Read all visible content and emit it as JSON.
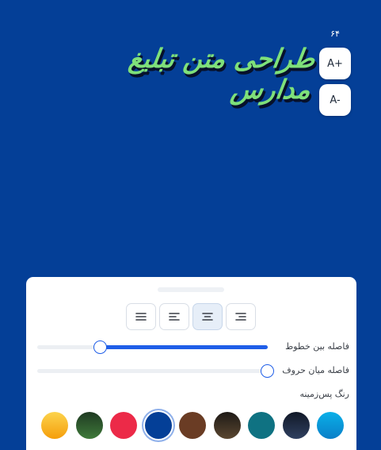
{
  "canvas": {
    "background_color": "#043f97",
    "headline_text": "طراحی متن تبلیغ مدارس",
    "headline_color": "#7ee07a",
    "font_size_value": "۶۴"
  },
  "size_controls": {
    "increase_label": "A+",
    "decrease_label": "A-"
  },
  "panel": {
    "alignment_options": [
      {
        "name": "justify",
        "icon": "align-justify-icon",
        "selected": false
      },
      {
        "name": "left",
        "icon": "align-left-icon",
        "selected": false
      },
      {
        "name": "center",
        "icon": "align-center-icon",
        "selected": true
      },
      {
        "name": "right",
        "icon": "align-right-icon",
        "selected": false
      }
    ],
    "line_spacing": {
      "label": "فاصله بین خطوط",
      "value_fraction": 0.73
    },
    "letter_spacing": {
      "label": "فاصله میان حروف",
      "value_fraction": 0.0
    },
    "background_color_label": "رنگ پس‌زمینه",
    "accent_color": "#1f5ee8",
    "swatches": [
      {
        "color": "#fbbf24",
        "selected": false
      },
      {
        "color": "#2c5a2e",
        "selected": false
      },
      {
        "color": "#ec2a48",
        "selected": false
      },
      {
        "color": "#043f97",
        "selected": true
      },
      {
        "color": "#6a3c24",
        "selected": false
      },
      {
        "color": "#3b2e1e",
        "selected": false
      },
      {
        "color": "#0f7282",
        "selected": false
      },
      {
        "color": "#1c2a48",
        "selected": false
      },
      {
        "color": "#0ea1dd",
        "selected": false
      }
    ]
  }
}
